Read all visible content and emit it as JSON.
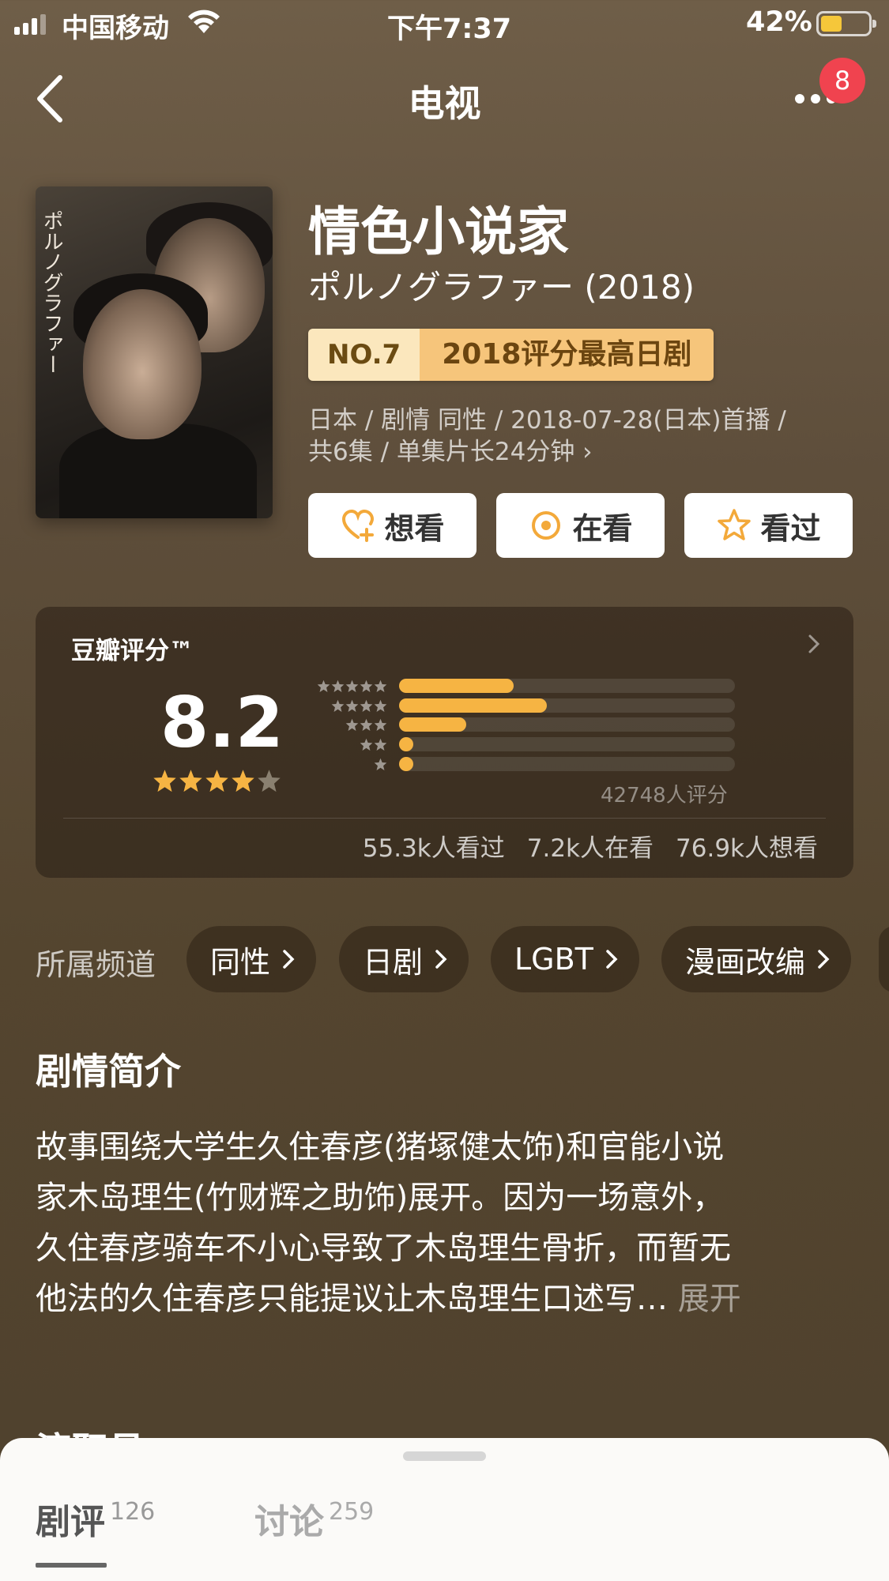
{
  "status_bar": {
    "carrier": "中国移动",
    "time": "下午7:37",
    "battery": "42%",
    "battery_level": 0.42
  },
  "nav": {
    "title": "电视",
    "badge": "8",
    "icons": [
      "back-icon",
      "more-icon"
    ]
  },
  "show": {
    "title": "情色小说家",
    "original_title": "ポルノグラファー (2018)",
    "poster_text": "ポルノグラファー",
    "rank_no": "NO.7",
    "rank_desc": "2018评分最高日剧",
    "meta_line1": "日本 / 剧情 同性 / 2018-07-28(日本)首播 /",
    "meta_line2": "共6集 / 单集片长24分钟 ›"
  },
  "actions": {
    "want": "想看",
    "watching": "在看",
    "watched": "看过"
  },
  "rating": {
    "label": "豆瓣评分™",
    "score": "8.2",
    "stars": 4,
    "distribution": [
      {
        "stars": 5,
        "fraction": 0.34
      },
      {
        "stars": 4,
        "fraction": 0.44
      },
      {
        "stars": 3,
        "fraction": 0.2
      },
      {
        "stars": 2,
        "fraction": 0.04
      },
      {
        "stars": 1,
        "fraction": 0.04
      }
    ],
    "total": "42748人评分",
    "watched": "55.3k人看过",
    "watching": "7.2k人在看",
    "want": "76.9k人想看"
  },
  "channels": {
    "label": "所属频道",
    "items": [
      "同性",
      "日剧",
      "LGBT",
      "漫画改编"
    ]
  },
  "synopsis": {
    "title": "剧情简介",
    "line1": "故事围绕大学生久住春彦(猪塚健太饰)和官能小说",
    "line2": "家木岛理生(竹财辉之助饰)展开。因为一场意外，",
    "line3": "久住春彦骑车不小心导致了木岛理生骨折，而暂无",
    "line4": "他法的久住春彦只能提议让木岛理生口述写…",
    "more": " 展开"
  },
  "cast_peek": "演职员",
  "sheet": {
    "tab_review": "剧评",
    "tab_review_count": "126",
    "tab_discuss": "讨论",
    "tab_discuss_count": "259"
  },
  "colors": {
    "accent_orange": "#f6b443",
    "badge_red": "#f0434f",
    "rank_light": "#fbe7bd",
    "rank_dark": "#f6c57b"
  }
}
